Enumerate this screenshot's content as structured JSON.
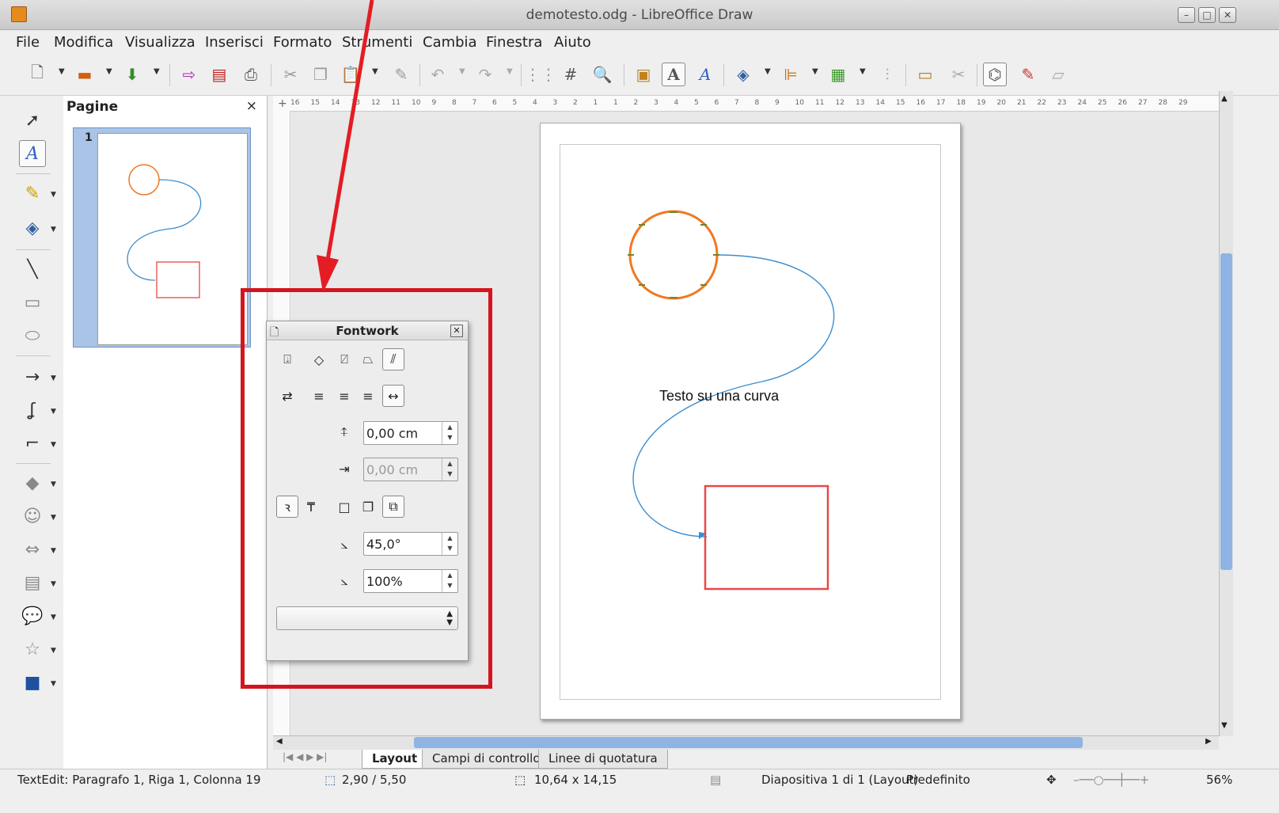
{
  "window": {
    "title": "demotesto.odg - LibreOffice Draw",
    "buttons": [
      "minimize",
      "maximize",
      "close"
    ]
  },
  "menu": [
    "File",
    "Modifica",
    "Visualizza",
    "Inserisci",
    "Formato",
    "Strumenti",
    "Cambia",
    "Finestra",
    "Aiuto"
  ],
  "toolbar": {
    "icons": [
      "new-icon",
      "open-icon",
      "save-icon",
      "export-icon",
      "export-pdf-icon",
      "print-icon",
      "cut-icon",
      "copy-icon",
      "paste-icon",
      "clone-format-icon",
      "undo-icon",
      "redo-icon",
      "grid-icon",
      "helplines-icon",
      "zoom-icon",
      "image-icon",
      "fontwork-icon",
      "text-icon",
      "transform-icon",
      "align-icon",
      "arrange-icon",
      "distribute-icon",
      "shadow-icon",
      "crop-icon",
      "points-icon",
      "glue-icon",
      "extrusion-icon"
    ]
  },
  "lefttools": [
    "select-icon",
    "text-tool-icon",
    "line-color-icon",
    "fill-color-icon",
    "line-icon",
    "rectangle-icon",
    "ellipse-icon",
    "arrow-line-icon",
    "curve-icon",
    "connector-icon",
    "basic-shapes-icon",
    "symbol-shapes-icon",
    "block-arrows-icon",
    "flowchart-icon",
    "callouts-icon",
    "stars-icon",
    "3d-objects-icon"
  ],
  "pages_panel": {
    "title": "Pagine",
    "close": "×",
    "page_number": "1"
  },
  "ruler": {
    "labels": [
      "16",
      "15",
      "14",
      "13",
      "12",
      "11",
      "10",
      "9",
      "8",
      "7",
      "6",
      "5",
      "4",
      "3",
      "2",
      "1",
      "1",
      "2",
      "3",
      "4",
      "5",
      "6",
      "7",
      "8",
      "9",
      "10",
      "11",
      "12",
      "13",
      "14",
      "15",
      "16",
      "17",
      "18",
      "19",
      "20",
      "21",
      "22",
      "23",
      "24",
      "25",
      "26",
      "27",
      "28",
      "29"
    ]
  },
  "canvas": {
    "curve_text": "Testo su una curva"
  },
  "fontwork": {
    "title": "Fontwork",
    "distance_value": "0,00 cm",
    "indent_value": "0,00 cm",
    "angle_value": "45,0°",
    "size_value": "100%",
    "shadow_combo": ""
  },
  "tabs": [
    "Layout",
    "Campi di controllo",
    "Linee di quotatura"
  ],
  "status": {
    "mode": "TextEdit: Paragrafo 1, Riga 1, Colonna 19",
    "position": "2,90 / 5,50",
    "size": "10,64 x 14,15",
    "slide": "Diapositiva 1 di 1 (Layout)",
    "template": "Predefinito",
    "zoom": "56%"
  },
  "colors": {
    "annotation_red": "#d4141e",
    "circle_orange": "#f07820",
    "curve_blue": "#3b8ed0",
    "rect_red": "#e84848"
  }
}
